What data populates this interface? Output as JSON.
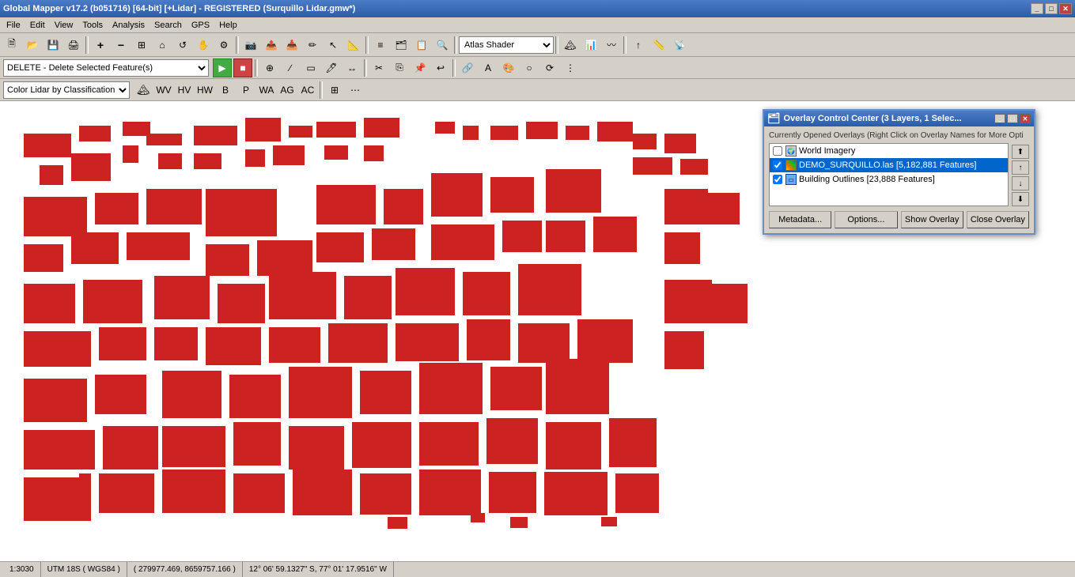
{
  "titleBar": {
    "title": "Global Mapper v17.2 (b051716) [64-bit] [+Lidar] - REGISTERED (Surquillo Lidar.gmw*)",
    "controls": [
      "minimize",
      "maximize",
      "close"
    ]
  },
  "menuBar": {
    "items": [
      "File",
      "Edit",
      "View",
      "Tools",
      "Analysis",
      "Search",
      "GPS",
      "Help"
    ]
  },
  "commandBar": {
    "selectedCommand": "DELETE - Delete Selected Feature(s)"
  },
  "renderBar": {
    "selectedRender": "Color Lidar by Classification"
  },
  "overlayDialog": {
    "title": "Overlay Control Center (3 Layers, 1 Selec...",
    "hint": "Currently Opened Overlays (Right Click on Overlay Names for More Opti",
    "layers": [
      {
        "id": 1,
        "name": "World Imagery",
        "checked": false,
        "type": "world",
        "selected": false
      },
      {
        "id": 2,
        "name": "DEMO_SURQUILLO.las [5,182,881 Features]",
        "checked": true,
        "type": "lidar",
        "selected": true
      },
      {
        "id": 3,
        "name": "Building Outlines [23,888 Features]",
        "checked": true,
        "type": "vector",
        "selected": false
      }
    ],
    "buttons": {
      "metadata": "Metadata...",
      "options": "Options...",
      "showOverlay": "Show Overlay",
      "closeOverlay": "Close Overlay"
    }
  },
  "statusBar": {
    "scale": "1:3030",
    "projection": "UTM 18S ( WGS84 )",
    "coordinates": "( 279977.469, 8659757.166 )",
    "latlon": "12° 06' 59.1327\" S, 77° 01' 17.9516\" W"
  },
  "toolbar": {
    "shaderLabel": "Atlas Shader"
  }
}
